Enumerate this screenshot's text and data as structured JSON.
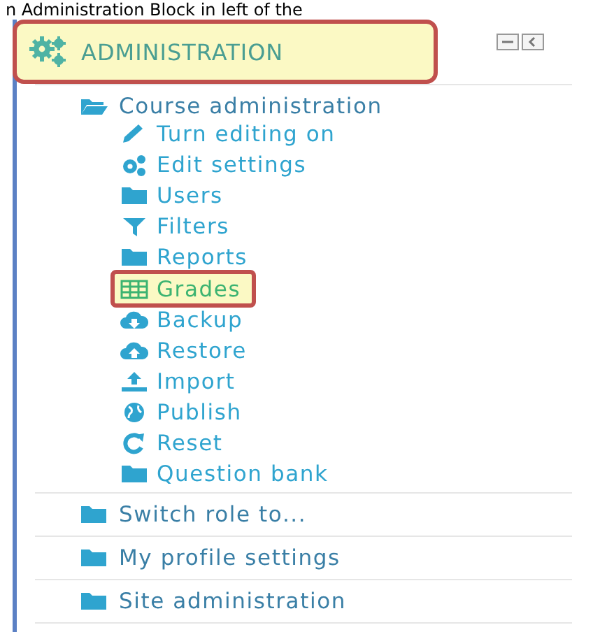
{
  "caption": "n Administration Block in left of the",
  "block": {
    "title": "ADMINISTRATION",
    "highlighted": true
  },
  "tree": [
    {
      "label": "Course administration",
      "expanded": true,
      "children": [
        {
          "label": "Turn editing on",
          "highlighted": false
        },
        {
          "label": "Edit settings",
          "highlighted": false
        },
        {
          "label": "Users",
          "highlighted": false
        },
        {
          "label": "Filters",
          "highlighted": false
        },
        {
          "label": "Reports",
          "highlighted": false
        },
        {
          "label": "Grades",
          "highlighted": true
        },
        {
          "label": "Backup",
          "highlighted": false
        },
        {
          "label": "Restore",
          "highlighted": false
        },
        {
          "label": "Import",
          "highlighted": false
        },
        {
          "label": "Publish",
          "highlighted": false
        },
        {
          "label": "Reset",
          "highlighted": false
        },
        {
          "label": "Question bank",
          "highlighted": false
        }
      ]
    },
    {
      "label": "Switch role to...",
      "expanded": false
    },
    {
      "label": "My profile settings",
      "expanded": false
    },
    {
      "label": "Site administration",
      "expanded": false
    }
  ]
}
